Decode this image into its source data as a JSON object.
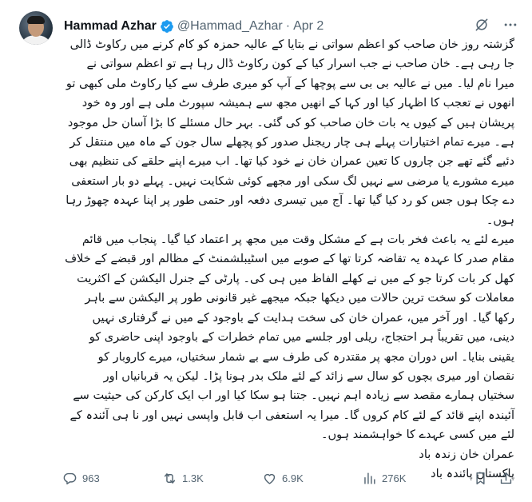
{
  "author": {
    "name": "Hammad Azhar",
    "handle": "@Hammad_Azhar",
    "separator": "·",
    "date": "Apr 2",
    "verified_color": "#1d9bf0"
  },
  "tweet": {
    "paragraphs": [
      "گزشتہ روز خان صاحب کو اعظم سواتی نے بتایا کے عالیہ حمزہ کو کام کرنے میں رکاوٹ ڈالی جا رہی ہے۔ خان صاحب نے جب اسرار کیا کے کون رکاوٹ ڈال رہا ہے تو اعظم سواتی نے میرا نام لیا۔ میں نے عالیہ بی بی سے پوچھا کے آپ کو میری طرف سے کیا رکاوٹ ملی کبھی تو انھوں نے تعجب کا اظہار کیا اور کہا کے انھیں مجھ سے ہمیشہ سپورٹ ملی ہے اور وہ خود پریشان ہیں کے کیوں یہ بات خان صاحب کو کی گئی۔ بہر حال مسئلے کا بڑا آسان حل موجود ہے۔ میرے تمام اختیارات پہلے ہی چار ریجنل صدور کو پچھلے سال  جون کے ماہ میں منتقل کر دئیے گئے تھے جن چاروں کا تعین عمران خان نے خود کیا تھا۔ اب میرے اپنے حلقے کی تنظیم بھی میرے مشورے یا مرضی سے نہیں لگ سکی اور مجھے کوئی شکایت نہیں۔ پہلے دو بار استعفی دے چکا ہوں جس کو رد کیا گیا تھا۔ آج میں تیسری دفعہ اور حتمی طور پر اپنا عہدہ چھوڑ رہا ہوں۔",
      "میرے لئے یہ باعث فخر بات ہے کے مشکل وقت میں مجھ پر اعتماد کیا گیا۔ پنجاب میں قائم مقام صدر کا عہدہ یہ تقاضہ کرتا تھا کے صوبے میں اسٹیبلشمنٹ کے مظالم اور قبضے کے خلاف کھل کر بات  کرتا جو کے میں نے کھلے الفاظ میں ہی کی۔ پارٹی کے جنرل الیکشن کے اکثریت معاملات کو سخت ترین حالات میں دیکھا جبکہ میجھے غیر قانونی طور پر الیکشن سے باہر رکھا گیا۔ اور آخر میں، عمران خان کی سخت ہدایت کے باوجود کے میں نے گرفتاری نہیں دینی، میں تقریباً ہر احتجاج، ریلی اور جلسے میں تمام خطرات کے باوجود اپنی حاضری کو یقینی بنایا۔ اس دوران مجھ پر مقتدرہ کی طرف سے بے شمار سختیاں، میرے کاروبار کو نقصان اور میری بچوں کو سال سے زائد کے لئے ملک بدر ہونا پڑا۔ لیکن یہ قربانیاں اور سختیاں ہمارے مقصد سے زیادہ اہم نہیں۔ جتنا ہو سکا کیا اور اب ایک کارکن کی حیثیت سے آئیندہ اپنے قائد کے لئے  کام کروں گا۔ میرا یہ استعفی اب قابل واپسی نہیں اور نا ہی آئندہ کے لئے میں کسی عہدے کا خواہشمند ہوں۔"
    ],
    "closing_line_1": "عمران خان زندہ باد",
    "closing_line_2": "پاکستان پائندہ باد"
  },
  "actions": {
    "replies": "963",
    "retweets": "1.3K",
    "likes": "6.9K",
    "views": "276K"
  },
  "icons": {
    "grok": "grok-icon",
    "more": "more-icon",
    "reply": "reply-icon",
    "retweet": "retweet-icon",
    "like": "heart-icon",
    "views": "views-icon",
    "bookmark": "bookmark-icon",
    "share": "share-icon"
  },
  "colors": {
    "text": "#0f1419",
    "muted": "#536471",
    "verified": "#1d9bf0"
  }
}
